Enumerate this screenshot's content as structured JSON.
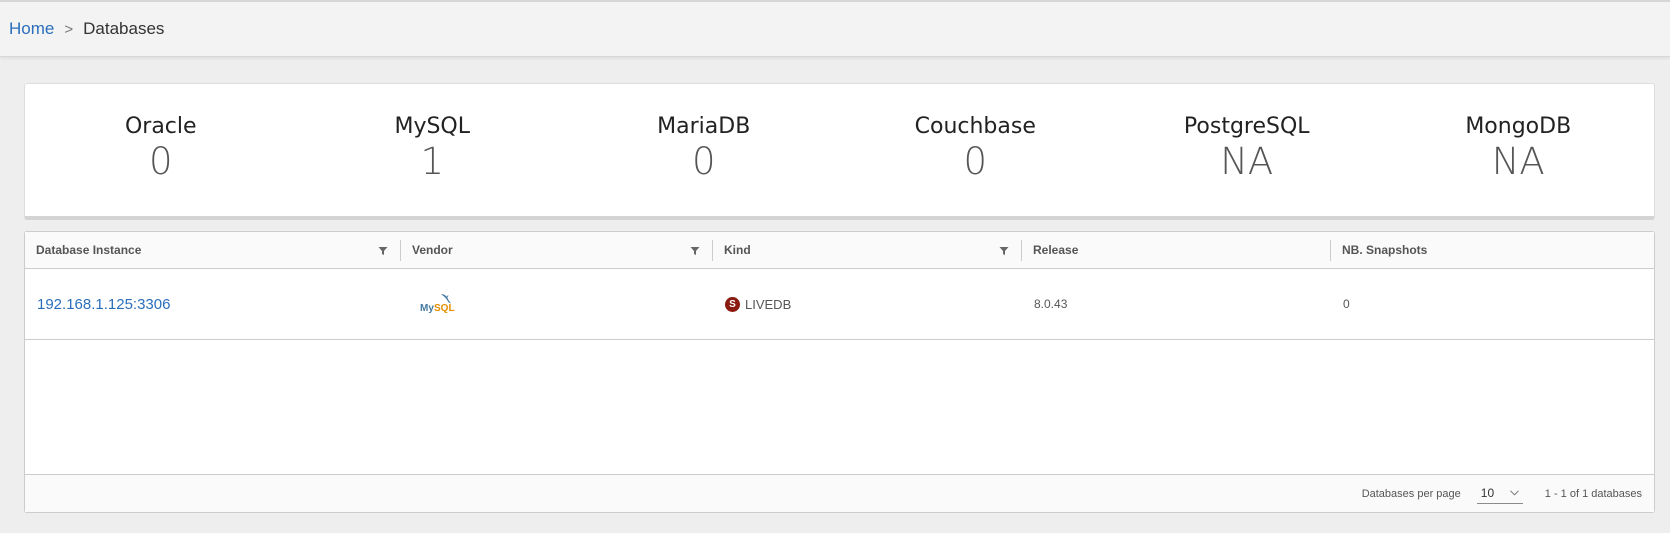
{
  "breadcrumb": {
    "home": "Home",
    "separator": ">",
    "current": "Databases"
  },
  "stats": [
    {
      "name": "Oracle",
      "value": "0"
    },
    {
      "name": "MySQL",
      "value": "1"
    },
    {
      "name": "MariaDB",
      "value": "0"
    },
    {
      "name": "Couchbase",
      "value": "0"
    },
    {
      "name": "PostgreSQL",
      "value": "NA"
    },
    {
      "name": "MongoDB",
      "value": "NA"
    }
  ],
  "table": {
    "columns": [
      "Database Instance",
      "Vendor",
      "Kind",
      "Release",
      "NB. Snapshots"
    ],
    "rows": [
      {
        "instance": "192.168.1.125:3306",
        "vendor": "MySQL",
        "vendor_icon": "mysql-logo-icon",
        "kind_badge": "S",
        "kind": "LIVEDB",
        "release": "8.0.43",
        "snapshots": "0"
      }
    ]
  },
  "footer": {
    "per_page_label": "Databases per page",
    "per_page_value": "10",
    "summary": "1 - 1 of 1 databases"
  },
  "colors": {
    "link": "#2a6ebb",
    "kind_badge": "#8b1a10",
    "mysql_blue": "#4479a1",
    "mysql_orange": "#e48e00"
  }
}
